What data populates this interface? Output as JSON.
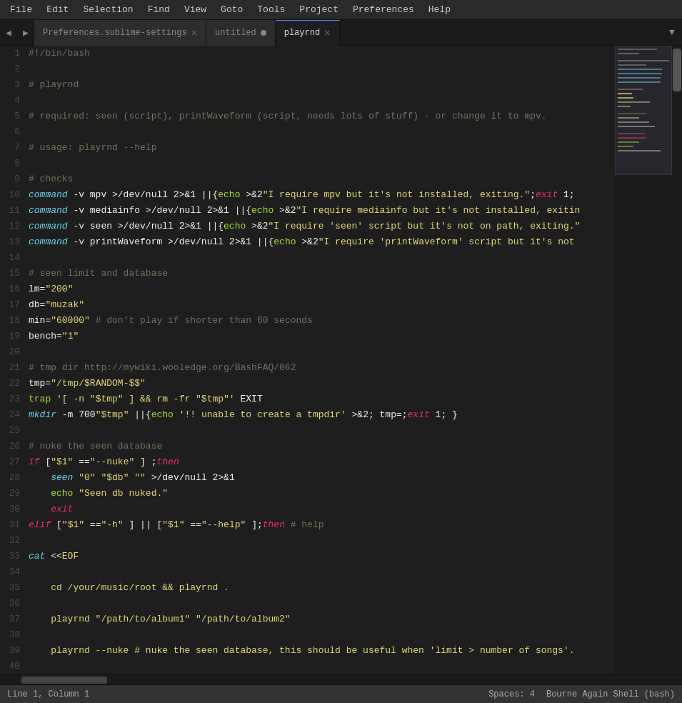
{
  "menubar": {
    "items": [
      "File",
      "Edit",
      "Selection",
      "Find",
      "View",
      "Goto",
      "Tools",
      "Project",
      "Preferences",
      "Help"
    ]
  },
  "tabbar": {
    "tabs": [
      {
        "id": "tab-prefs",
        "label": "Preferences.sublime-settings",
        "active": false,
        "dirty": false,
        "closeable": true
      },
      {
        "id": "tab-untitled",
        "label": "untitled",
        "active": false,
        "dirty": true,
        "closeable": false
      },
      {
        "id": "tab-playrnd",
        "label": "playrnd",
        "active": true,
        "dirty": false,
        "closeable": true
      }
    ]
  },
  "editor": {
    "lines": [
      "#!/bin/bash",
      "",
      "# playrnd",
      "",
      "# required: seen (script), printWaveform (script, needs lots of stuff) - or change it to mpv.",
      "",
      "# usage: playrnd --help",
      "",
      "# checks",
      "command -v mpv >/dev/null 2>&1 || { echo >&2 \"I require mpv but it's not installed, exiting.\"; exit 1;",
      "command -v mediainfo >/dev/null 2>&1 || { echo >&2 \"I require mediainfo but it's not installed, exitin",
      "command -v seen >/dev/null 2>&1 || { echo >&2 \"I require 'seen' script but it's not on path, exiting.\"",
      "command -v printWaveform >/dev/null 2>&1 || { echo >&2 \"I require 'printWaveform' script but it's not",
      "",
      "# seen limit and database",
      "lm=\"200\"",
      "db=\"muzak\"",
      "min=\"60000\" # don't play if shorter than 60 seconds",
      "bench=\"1\"",
      "",
      "# tmp dir http://mywiki.wooledge.org/BashFAQ/062",
      "tmp=\"/tmp/$RANDOM-$$\"",
      "trap '[ -n \"$tmp\" ] && rm -fr \"$tmp\"' EXIT",
      "mkdir -m 700 \"$tmp\" || { echo '!! unable to create a tmpdir' >&2; tmp=; exit 1; }",
      "",
      "# nuke the seen database",
      "if [ \"$1\" == \"--nuke\" ] ; then",
      "    seen \"0\" \"$db\" \"\" >/dev/null 2>&1",
      "    echo \"Seen db nuked.\"",
      "    exit",
      "elif [ \"$1\" == \"-h\" ] || [ \"$1\" == \"--help\" ]; then # help",
      "",
      "cat <<EOF",
      "",
      "    cd /your/music/root && playrnd .",
      "",
      "    playrnd \"/path/to/album1\" \"/path/to/album2\"",
      "",
      "    playrnd --nuke # nuke the seen database, this should be useful when 'limit > number of songs'.",
      "",
      ""
    ]
  },
  "statusbar": {
    "left": {
      "position": "Line 1, Column 1"
    },
    "right": {
      "spaces": "Spaces: 4",
      "syntax": "Bourne Again Shell (bash)"
    }
  }
}
